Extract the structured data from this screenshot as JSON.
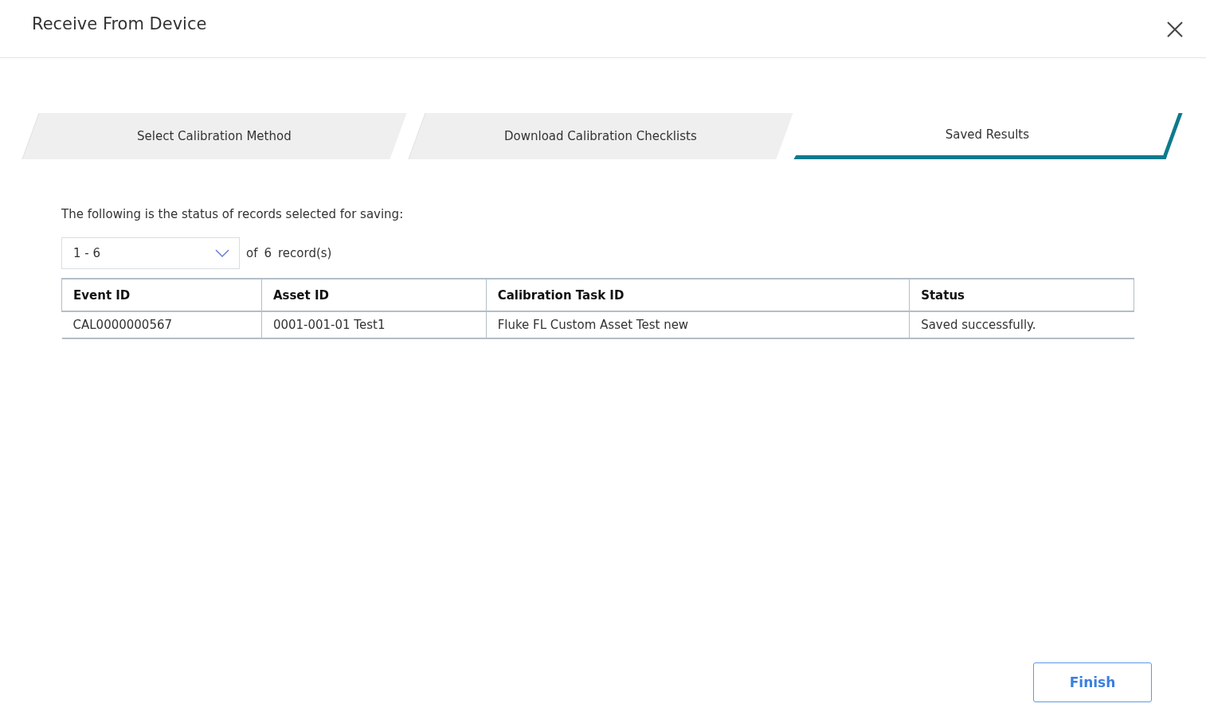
{
  "dialog": {
    "title": "Receive From Device"
  },
  "steps": [
    {
      "label": "Select Calibration Method",
      "selected": false
    },
    {
      "label": "Download Calibration Checklists",
      "selected": false
    },
    {
      "label": "Saved Results",
      "selected": true
    }
  ],
  "intro": "The following is the status of records selected for saving:",
  "pager": {
    "range": "1 - 6",
    "of_label": "of",
    "total": "6",
    "unit": "record(s)"
  },
  "table": {
    "columns": [
      "Event ID",
      "Asset ID",
      "Calibration Task ID",
      "Status"
    ],
    "rows": [
      [
        "CAL0000000567",
        "0001-001-01 Test1",
        "Fluke FL Custom Asset Test new",
        "Saved successfully."
      ]
    ]
  },
  "buttons": [
    "Finish"
  ]
}
